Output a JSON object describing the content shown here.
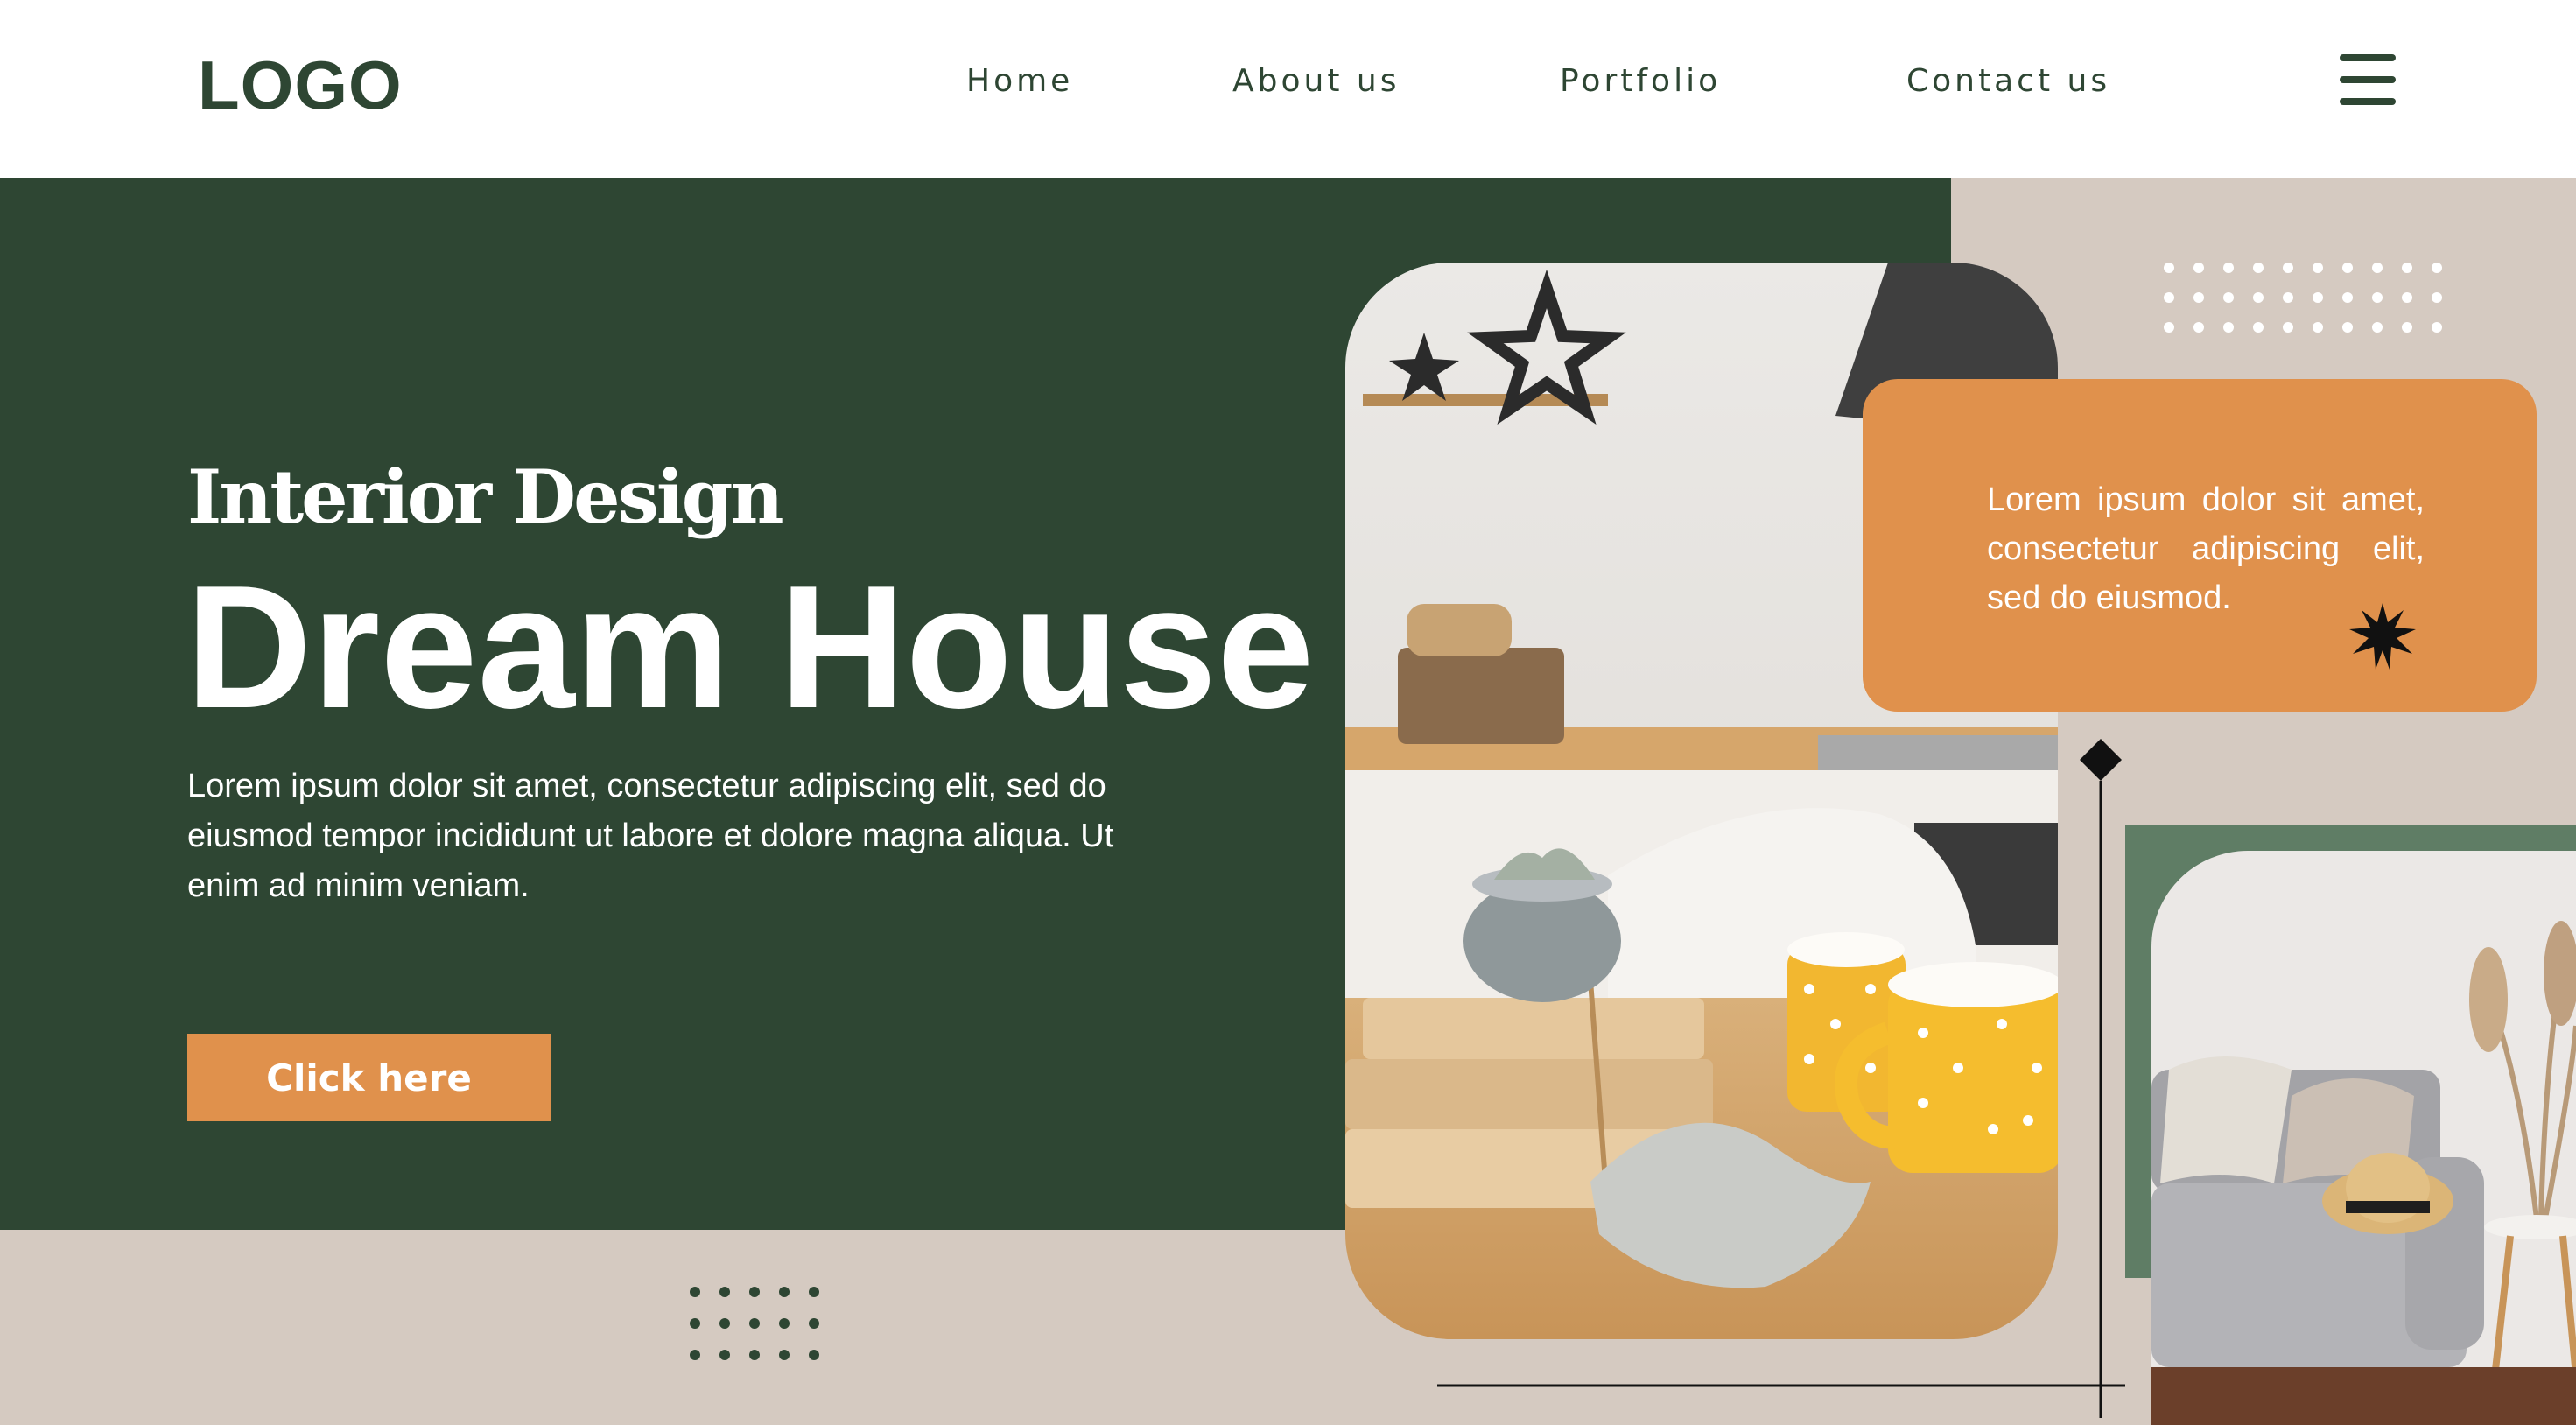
{
  "header": {
    "logo": "LOGO",
    "nav": [
      "Home",
      "About us",
      "Portfolio",
      "Contact us"
    ]
  },
  "hero": {
    "subtitle": "Interior Design",
    "title": "Dream House",
    "description": "Lorem ipsum dolor sit amet, consectetur adipiscing elit, sed do eiusmod tempor incididunt ut labore et dolore magna aliqua. Ut enim ad minim veniam.",
    "cta_label": "Click here"
  },
  "card": {
    "text": "Lorem ipsum dolor sit amet, consectetur adipiscing elit, sed do eiusmod."
  },
  "icons": {
    "menu": "hamburger-menu-icon",
    "burst": "star-burst-icon",
    "diamond": "diamond-icon"
  },
  "colors": {
    "dark_green": "#2e4633",
    "sage_green": "#5f7d65",
    "orange": "#e0914c",
    "beige": "#d5cac1",
    "white": "#ffffff"
  }
}
